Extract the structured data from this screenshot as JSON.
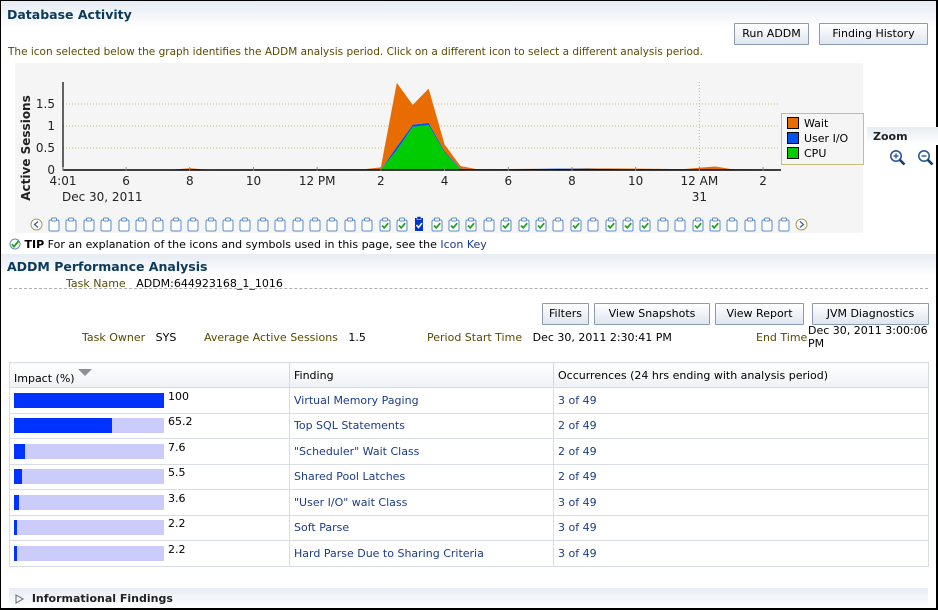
{
  "database_activity": {
    "title": "Database Activity",
    "buttons": {
      "run_addm": "Run ADDM",
      "finding_history": "Finding History"
    },
    "instructions": "The icon selected below the graph identifies the ADDM analysis period. Click on a different icon to select a different analysis period.",
    "zoom": {
      "label": "Zoom",
      "zoom_in_icon": "zoom-in-icon",
      "zoom_out_icon": "zoom-out-icon"
    },
    "snapshot_icons": {
      "prev_icon": "chevron-left-circle-icon",
      "next_icon": "chevron-right-circle-icon",
      "states": [
        "empty",
        "empty",
        "empty",
        "empty",
        "empty",
        "empty",
        "empty",
        "empty",
        "empty",
        "empty",
        "empty",
        "empty",
        "empty",
        "empty",
        "empty",
        "empty",
        "empty",
        "empty",
        "empty",
        "check",
        "check",
        "selected",
        "check",
        "check",
        "check",
        "empty",
        "check",
        "check",
        "check",
        "empty",
        "check",
        "empty",
        "check",
        "check",
        "check",
        "empty",
        "empty",
        "check",
        "check",
        "empty",
        "empty",
        "empty",
        "empty"
      ]
    },
    "tip": {
      "label": "TIP",
      "text": "For an explanation of the icons and symbols used in this page, see the",
      "link": "Icon Key"
    }
  },
  "chart_data": {
    "type": "area",
    "stacked": true,
    "title": "",
    "ylabel": "Active Sessions",
    "xlabel": "",
    "ylim": [
      0,
      2
    ],
    "y_ticks": [
      "0",
      "0.5",
      "1",
      "1.5"
    ],
    "x_ticks": [
      {
        "label": "4:01",
        "sublabel": "Dec 30, 2011",
        "hour": 4.02
      },
      {
        "label": "6",
        "hour": 6
      },
      {
        "label": "8",
        "hour": 8
      },
      {
        "label": "10",
        "hour": 10
      },
      {
        "label": "12 PM",
        "hour": 12
      },
      {
        "label": "2",
        "hour": 14
      },
      {
        "label": "4",
        "hour": 16
      },
      {
        "label": "6",
        "hour": 18
      },
      {
        "label": "8",
        "hour": 20
      },
      {
        "label": "10",
        "hour": 22
      },
      {
        "label": "12 AM",
        "sublabel": "31",
        "hour": 24
      },
      {
        "label": "2",
        "hour": 26
      }
    ],
    "xlim_hours": [
      4.02,
      26.5
    ],
    "grid": "horizontal-dotted",
    "marker_line_hour": 24,
    "legend": {
      "position": "right",
      "entries": [
        "Wait",
        "User I/O",
        "CPU"
      ]
    },
    "colors": {
      "Wait": "#e86c00",
      "User I/O": "#0055ee",
      "CPU": "#00cc00"
    },
    "x_hours": [
      4.02,
      7.5,
      8.0,
      8.5,
      13.5,
      14.0,
      14.5,
      15.0,
      15.5,
      16.0,
      16.5,
      17.0,
      19.5,
      20.5,
      22.0,
      23.5,
      24.0,
      24.5,
      25.0,
      26.5
    ],
    "series": [
      {
        "name": "CPU",
        "values": [
          0.01,
          0.01,
          0.01,
          0.01,
          0.01,
          0.01,
          0.45,
          0.98,
          1.02,
          0.4,
          0.02,
          0.01,
          0.01,
          0.01,
          0.01,
          0.01,
          0.02,
          0.02,
          0.01,
          0.01
        ]
      },
      {
        "name": "User I/O",
        "values": [
          0.0,
          0.0,
          0.0,
          0.0,
          0.0,
          0.0,
          0.08,
          0.05,
          0.05,
          0.03,
          0.01,
          0.0,
          0.02,
          0.02,
          0.0,
          0.0,
          0.0,
          0.0,
          0.0,
          0.0
        ]
      },
      {
        "name": "Wait",
        "values": [
          0.0,
          0.0,
          0.03,
          0.0,
          0.01,
          0.05,
          1.45,
          0.45,
          0.78,
          0.15,
          0.06,
          0.01,
          0.0,
          0.01,
          0.02,
          0.01,
          0.03,
          0.06,
          0.01,
          0.0
        ]
      }
    ]
  },
  "addm": {
    "title": "ADDM Performance Analysis",
    "task_name_label": "Task Name",
    "task_name": "ADDM:644923168_1_1016",
    "buttons": {
      "filters": "Filters",
      "view_snapshots": "View Snapshots",
      "view_report": "View Report",
      "jvm_diagnostics": "JVM Diagnostics"
    },
    "task_owner_label": "Task Owner",
    "task_owner": "SYS",
    "avg_sessions_label": "Average Active Sessions",
    "avg_sessions": "1.5",
    "period_start_label": "Period Start Time",
    "period_start": "Dec 30, 2011 2:30:41 PM",
    "end_time_label": "End Time",
    "end_time": "Dec 30, 2011 3:00:06 PM"
  },
  "findings_table": {
    "columns": [
      "Impact (%)",
      "Finding",
      "Occurrences (24 hrs ending with analysis period)"
    ],
    "sort_icon": "sort-descending-icon",
    "rows": [
      {
        "impact": "100",
        "impact_value": 100,
        "finding": "Virtual Memory Paging",
        "occurrences": "3 of 49"
      },
      {
        "impact": "65.2",
        "impact_value": 65.2,
        "finding": "Top SQL Statements",
        "occurrences": "2 of 49"
      },
      {
        "impact": "7.6",
        "impact_value": 7.6,
        "finding": "\"Scheduler\" Wait Class",
        "occurrences": "2 of 49"
      },
      {
        "impact": "5.5",
        "impact_value": 5.5,
        "finding": "Shared Pool Latches",
        "occurrences": "2 of 49"
      },
      {
        "impact": "3.6",
        "impact_value": 3.6,
        "finding": "\"User I/O\" wait Class",
        "occurrences": "3 of 49"
      },
      {
        "impact": "2.2",
        "impact_value": 2.2,
        "finding": "Soft Parse",
        "occurrences": "3 of 49"
      },
      {
        "impact": "2.2",
        "impact_value": 2.2,
        "finding": "Hard Parse Due to Sharing Criteria",
        "occurrences": "3 of 49"
      }
    ]
  },
  "informational_findings": {
    "label": "Informational Findings",
    "icon": "expand-triangle-icon"
  }
}
